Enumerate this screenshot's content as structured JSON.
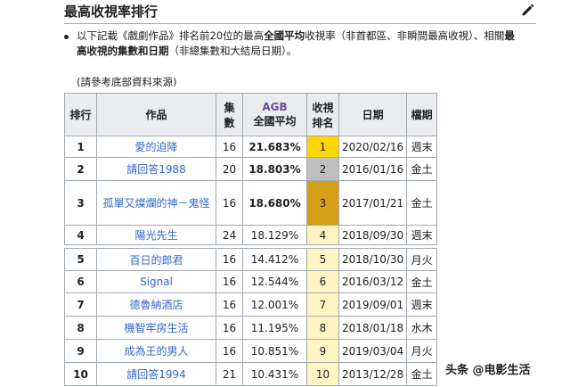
{
  "heading": {
    "title": "最高收視率排行"
  },
  "intro": {
    "part1": "以下記載《戲劇作品》排名前20位的最高",
    "bold1": "全國平均",
    "part2": "收視率（非首都區、非瞬間最高收視）、相關",
    "bold2": "最高收視的集數和日期",
    "part3": "（非總集數和大結局日期）。"
  },
  "ref_note": "(請參考底部資料來源)",
  "table": {
    "headers": {
      "rank": "排行",
      "title": "作品",
      "episodes": "集數",
      "agb_line1": "AGB",
      "agb_line2": "全國平均",
      "ratingrank_line1": "收視",
      "ratingrank_line2": "排名",
      "date": "日期",
      "slot": "檔期"
    },
    "rows": [
      {
        "rank": "1",
        "title": "愛的迫降",
        "episodes": "16",
        "rating": "21.683%",
        "rating_rank": "1",
        "date": "2020/02/16",
        "slot": "週末"
      },
      {
        "rank": "2",
        "title": "請回答1988",
        "episodes": "20",
        "rating": "18.803%",
        "rating_rank": "2",
        "date": "2016/01/16",
        "slot": "金土"
      },
      {
        "rank": "3",
        "title": "孤單又燦爛的神－鬼怪",
        "episodes": "16",
        "rating": "18.680%",
        "rating_rank": "3",
        "date": "2017/01/21",
        "slot": "金土"
      },
      {
        "rank": "4",
        "title": "陽光先生",
        "episodes": "24",
        "rating": "18.129%",
        "rating_rank": "4",
        "date": "2018/09/30",
        "slot": "週末"
      },
      {
        "rank": "5",
        "title": "百日的郎君",
        "episodes": "16",
        "rating": "14.412%",
        "rating_rank": "5",
        "date": "2018/10/30",
        "slot": "月火"
      },
      {
        "rank": "6",
        "title": "Signal",
        "episodes": "16",
        "rating": "12.544%",
        "rating_rank": "6",
        "date": "2016/03/12",
        "slot": "金土"
      },
      {
        "rank": "7",
        "title": "德魯納酒店",
        "episodes": "16",
        "rating": "12.001%",
        "rating_rank": "7",
        "date": "2019/09/01",
        "slot": "週末"
      },
      {
        "rank": "8",
        "title": "機智牢房生活",
        "episodes": "16",
        "rating": "11.195%",
        "rating_rank": "8",
        "date": "2018/01/18",
        "slot": "水木"
      },
      {
        "rank": "9",
        "title": "成為王的男人",
        "episodes": "16",
        "rating": "10.851%",
        "rating_rank": "9",
        "date": "2019/03/04",
        "slot": "月火"
      },
      {
        "rank": "10",
        "title": "請回答1994",
        "episodes": "21",
        "rating": "10.431%",
        "rating_rank": "10",
        "date": "2013/12/28",
        "slot": "金土"
      }
    ]
  },
  "watermark": "头条 @电影生活",
  "icons": {
    "edit": "pencil-icon"
  }
}
